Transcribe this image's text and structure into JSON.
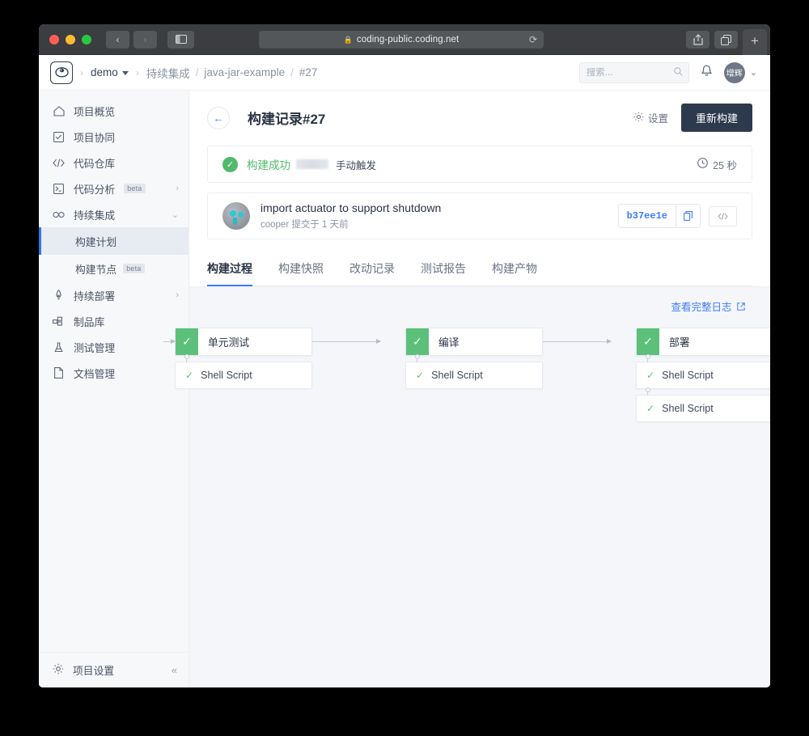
{
  "browser": {
    "url": "coding-public.coding.net",
    "lock_icon": "lock-icon",
    "back_icon": "‹",
    "forward_icon": "›",
    "sidebar_icon": "▣",
    "reload_icon": "⟳",
    "share_icon": "⇪",
    "tabs_icon": "❐",
    "newtab_icon": "+"
  },
  "topbar": {
    "logo_alt": "coding-logo",
    "breadcrumb": {
      "project": "demo",
      "section": "持续集成",
      "repo": "java-jar-example",
      "build": "#27"
    },
    "search_placeholder": "搜索...",
    "search_value": "",
    "notification_icon": "bell-icon",
    "avatar_initials": "增辉",
    "chevron_icon": "⌄"
  },
  "sidebar": {
    "items": [
      {
        "icon": "home-icon",
        "glyph": "⌂",
        "label": "项目概览",
        "badge": "",
        "arrow": ""
      },
      {
        "icon": "checkbox-icon",
        "glyph": "☑",
        "label": "项目协同",
        "badge": "",
        "arrow": ""
      },
      {
        "icon": "code-icon",
        "glyph": "‹/›",
        "label": "代码仓库",
        "badge": "",
        "arrow": ""
      },
      {
        "icon": "terminal-icon",
        "glyph": "▣",
        "label": "代码分析",
        "badge": "beta",
        "arrow": "›"
      },
      {
        "icon": "infinity-icon",
        "glyph": "∞",
        "label": "持续集成",
        "badge": "",
        "arrow": "⌄"
      }
    ],
    "subitems": [
      {
        "label": "构建计划",
        "badge": "",
        "active": true
      },
      {
        "label": "构建节点",
        "badge": "beta",
        "active": false
      }
    ],
    "items_after": [
      {
        "icon": "rocket-icon",
        "glyph": "⚲",
        "label": "持续部署",
        "badge": "",
        "arrow": "›"
      },
      {
        "icon": "package-icon",
        "glyph": "⊞",
        "label": "制品库",
        "badge": "",
        "arrow": ""
      },
      {
        "icon": "flask-icon",
        "glyph": "⌬",
        "label": "测试管理",
        "badge": "",
        "arrow": "›"
      },
      {
        "icon": "document-icon",
        "glyph": "🗋",
        "label": "文档管理",
        "badge": "",
        "arrow": "›"
      }
    ],
    "footer": {
      "icon": "gear-icon",
      "glyph": "⚙",
      "label": "项目设置",
      "collapse_icon": "«"
    }
  },
  "main": {
    "back_icon": "←",
    "title": "构建记录#27",
    "settings_label": "设置",
    "settings_icon": "gear-icon",
    "rebuild_label": "重新构建",
    "status": {
      "icon": "check-circle-icon",
      "text": "构建成功",
      "redacted": "",
      "trigger": "手动触发",
      "duration_icon": "clock-icon",
      "duration": "25 秒"
    },
    "commit": {
      "avatar_alt": "commit-author-avatar",
      "title": "import actuator to support shutdown",
      "meta": "cooper 提交于 1 天前",
      "hash": "b37ee1e",
      "copy_icon": "copy-icon",
      "code_icon": "‹/›"
    },
    "tabs": [
      {
        "label": "构建过程",
        "active": true
      },
      {
        "label": "构建快照",
        "active": false
      },
      {
        "label": "改动记录",
        "active": false
      },
      {
        "label": "测试报告",
        "active": false
      },
      {
        "label": "构建产物",
        "active": false
      }
    ],
    "pipeline": {
      "log_link": "查看完整日志",
      "log_link_icon": "external-link-icon",
      "stages": [
        {
          "name": "单元测试",
          "status_icon": "check-icon",
          "status_color": "#5cc07a",
          "jobs": [
            {
              "name": "Shell Script",
              "status_icon": "check-icon"
            }
          ]
        },
        {
          "name": "编译",
          "status_icon": "check-icon",
          "status_color": "#5cc07a",
          "jobs": [
            {
              "name": "Shell Script",
              "status_icon": "check-icon"
            }
          ]
        },
        {
          "name": "部署",
          "status_icon": "check-icon",
          "status_color": "#5cc07a",
          "jobs": [
            {
              "name": "Shell Script",
              "status_icon": "check-icon"
            },
            {
              "name": "Shell Script",
              "status_icon": "check-icon"
            }
          ]
        }
      ]
    }
  },
  "colors": {
    "accent_blue": "#3e7bfa",
    "success_green": "#5cc07a",
    "dark_button": "#2d3a4e"
  }
}
